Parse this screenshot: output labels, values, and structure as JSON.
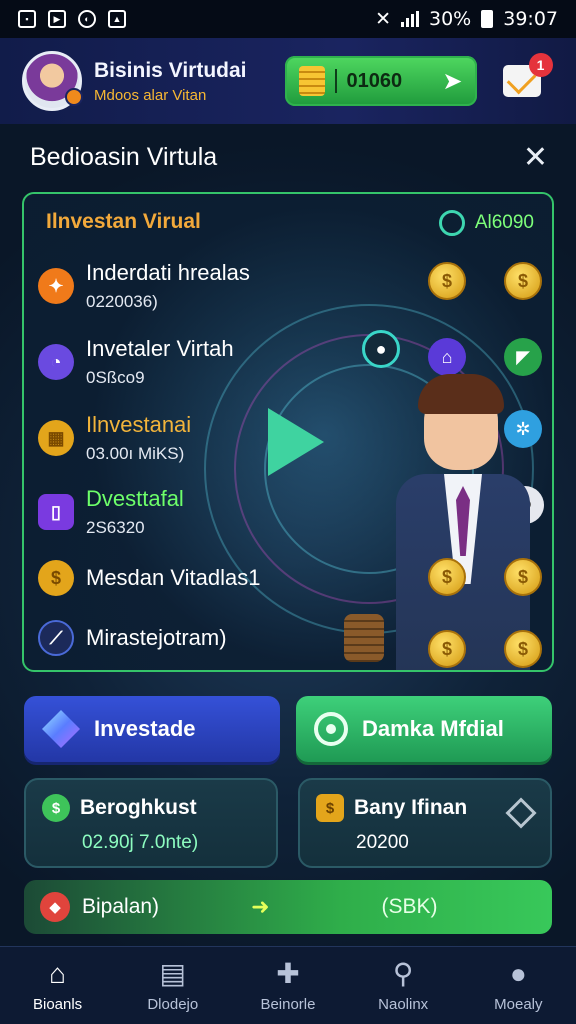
{
  "status_bar": {
    "time": "39:07",
    "battery": "30%",
    "icons": [
      "gallery-icon",
      "message-icon",
      "whatsapp-icon",
      "image-icon"
    ]
  },
  "header": {
    "title": "Bisinis Virtudai",
    "subtitle": "Mdoos alar Vitan",
    "coin_value": "01060",
    "mail_badge": "1"
  },
  "page": {
    "title": "Bedioasin Virtula"
  },
  "panel": {
    "title": "Ilnvestan Virual",
    "timer": "Al6090",
    "rows": [
      {
        "title": "Inderdati hrealas",
        "sub": "0220036)",
        "icon": "shield-icon",
        "color": "#f07a1a"
      },
      {
        "title": "Invetaler Virtah",
        "sub": "0Sßco9",
        "icon": "clock-icon",
        "color": "#6a4ae0"
      },
      {
        "title": "Ilnvestanai",
        "sub": "03.00ı MiKS)",
        "icon": "chip-icon",
        "color": "#e3a51b"
      },
      {
        "title": "Dvesttafal",
        "sub": "2S6320",
        "icon": "phone-icon",
        "color": "#7a3ae0"
      },
      {
        "title": "Mesdan Vitadlas1",
        "sub": "",
        "icon": "dollar-coin-icon",
        "color": "#e3a51b"
      },
      {
        "title": "Mirastejotram)",
        "sub": "",
        "icon": "compass-icon",
        "color": "#3a56c8"
      }
    ]
  },
  "actions": {
    "invest_label": "Investade",
    "demo_label": "Damka Mfdial"
  },
  "cards": {
    "left": {
      "title": "Beroghkust",
      "value": "02.90j 7.0nte)"
    },
    "right": {
      "title": "Bany Ifinan",
      "value": "20200"
    }
  },
  "wide": {
    "label": "Bipalan)",
    "value": "(SBK)"
  },
  "nav": [
    {
      "label": "Bioanls",
      "icon": "home-icon"
    },
    {
      "label": "Dlodejo",
      "icon": "document-icon"
    },
    {
      "label": "Beinorle",
      "icon": "puzzle-icon"
    },
    {
      "label": "Naolinx",
      "icon": "search-icon"
    },
    {
      "label": "Moealy",
      "icon": "profile-icon"
    }
  ],
  "colors": {
    "accent_green": "#35c46a",
    "accent_blue": "#2a3fbf",
    "panel_title": "#f2a93b"
  }
}
